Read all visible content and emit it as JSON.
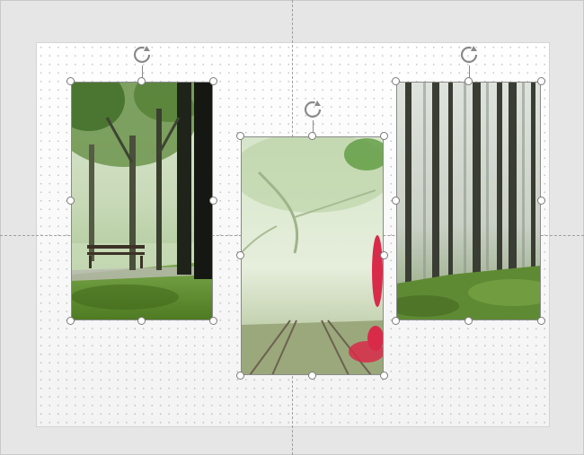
{
  "icons": {
    "rotate": "rotate-handle-icon",
    "handle": "resize-handle"
  },
  "colors": {
    "workspace": "#e6e6e6",
    "slide": "#ffffff",
    "handle_border": "#7b7b7b"
  }
}
